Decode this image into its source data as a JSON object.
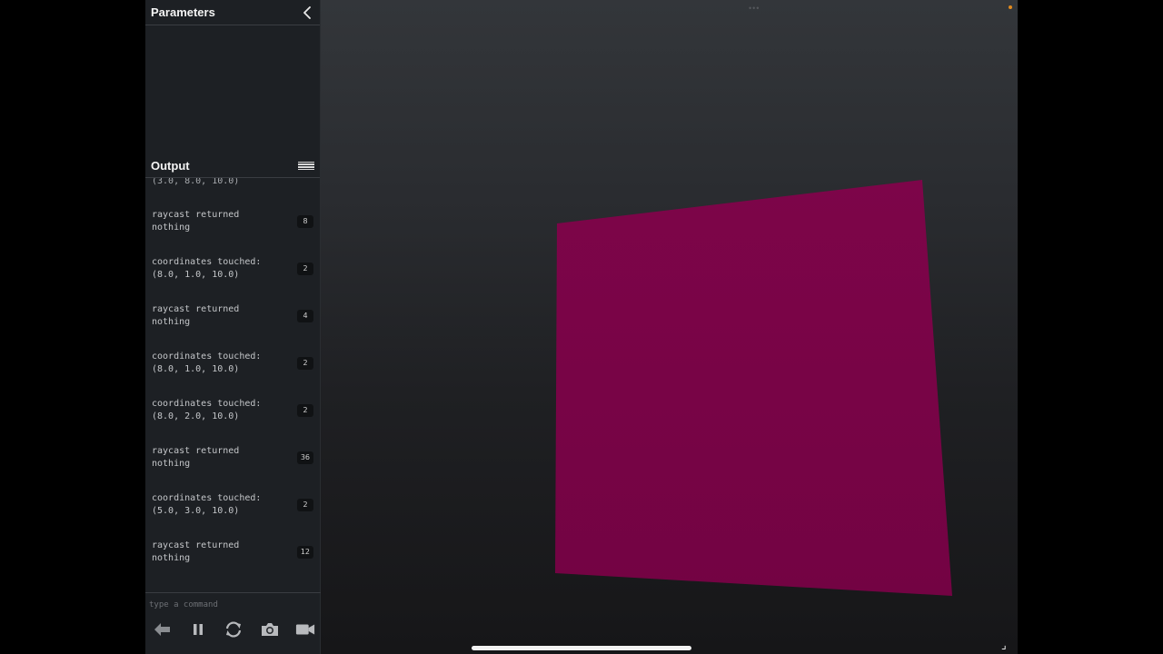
{
  "panel": {
    "parameters_title": "Parameters",
    "output_title": "Output",
    "partial_entry": "(3.0, 8.0, 10.0)",
    "log": [
      {
        "text": "raycast returned\nnothing",
        "count": "8"
      },
      {
        "text": "coordinates touched:\n(8.0, 1.0, 10.0)",
        "count": "2"
      },
      {
        "text": "raycast returned\nnothing",
        "count": "4"
      },
      {
        "text": "coordinates touched:\n(8.0, 1.0, 10.0)",
        "count": "2"
      },
      {
        "text": "coordinates touched:\n(8.0, 2.0, 10.0)",
        "count": "2"
      },
      {
        "text": "raycast returned\nnothing",
        "count": "36"
      },
      {
        "text": "coordinates touched:\n(5.0, 3.0, 10.0)",
        "count": "2"
      },
      {
        "text": "raycast returned\nnothing",
        "count": "12"
      }
    ],
    "command_placeholder": "type a command"
  },
  "toolbar": {
    "icons": [
      "back-arrow-icon",
      "pause-icon",
      "refresh-icon",
      "camera-icon",
      "video-camera-icon"
    ]
  },
  "scene": {
    "plane_color": "#7a0447",
    "background_top": "#33363a",
    "background_bottom": "#161618"
  },
  "colors": {
    "panel_bg": "#1d2024",
    "text": "#c4c6c9",
    "status_dot": "#e08a1e"
  }
}
